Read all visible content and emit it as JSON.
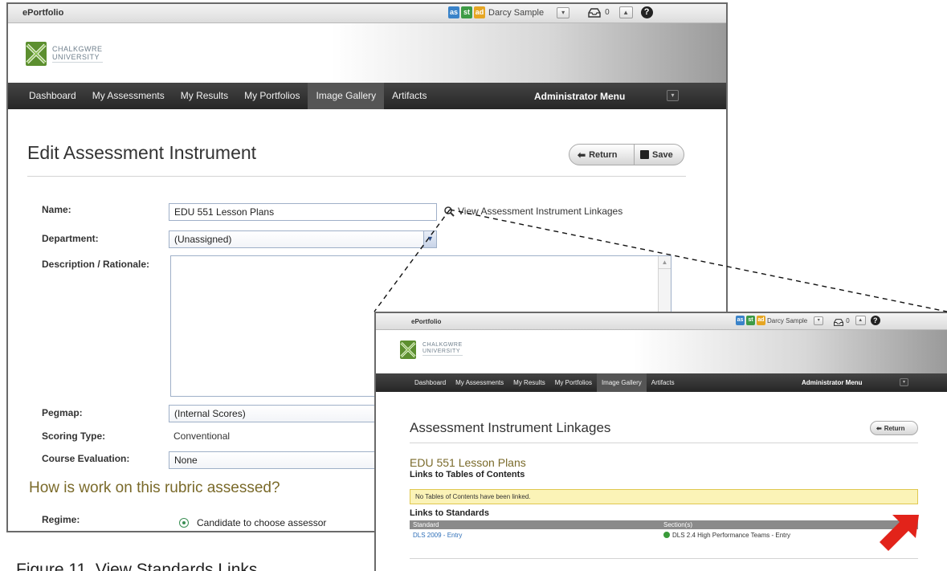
{
  "colors": {
    "nav_bg": "#2f2f2f",
    "accent_gold": "#7a6a2a",
    "link_blue": "#2e6fb8",
    "notice_yellow": "#fbf3b7",
    "callout_arrow": "#e2231a"
  },
  "app": {
    "name": "ePortfolio",
    "role_badges": [
      "as",
      "st",
      "ad"
    ],
    "user_name": "Darcy Sample",
    "inbox_count": "0",
    "brand_line1": "CHALKGWRE",
    "brand_line2": "UNIVERSITY",
    "icons": [
      "user-dropdown-icon",
      "inbox-icon",
      "collapse-icon",
      "help-icon"
    ]
  },
  "nav": {
    "items": [
      "Dashboard",
      "My Assessments",
      "My Results",
      "My Portfolios",
      "Image Gallery",
      "Artifacts"
    ],
    "admin_menu": "Administrator Menu"
  },
  "edit_page": {
    "title": "Edit Assessment Instrument",
    "return_label": "Return",
    "save_label": "Save",
    "name_label": "Name:",
    "name_value": "EDU 551 Lesson Plans",
    "linkages_link": "View Assessment Instrument Linkages",
    "department_label": "Department:",
    "department_value": "(Unassigned)",
    "description_label": "Description / Rationale:",
    "pegmap_label": "Pegmap:",
    "pegmap_value": "(Internal Scores)",
    "scoring_type_label": "Scoring Type:",
    "scoring_type_value": "Conventional",
    "course_eval_label": "Course Evaluation:",
    "course_eval_value": "None",
    "section_heading": "How is work on this rubric assessed?",
    "regime_label": "Regime:",
    "regime_option": "Candidate to choose assessor"
  },
  "linkages_page": {
    "title": "Assessment Instrument Linkages",
    "return_label": "Return",
    "instrument_name": "EDU 551 Lesson Plans",
    "toc_heading": "Links to Tables of Contents",
    "toc_notice": "No Tables of Contents have been linked.",
    "standards_heading": "Links to Standards",
    "columns": [
      "Standard",
      "Section(s)"
    ],
    "rows": [
      {
        "standard": "DLS 2009 - Entry",
        "section": "DLS 2.4 High Performance Teams - Entry"
      }
    ]
  },
  "caption": "Figure 11. View Standards Links"
}
